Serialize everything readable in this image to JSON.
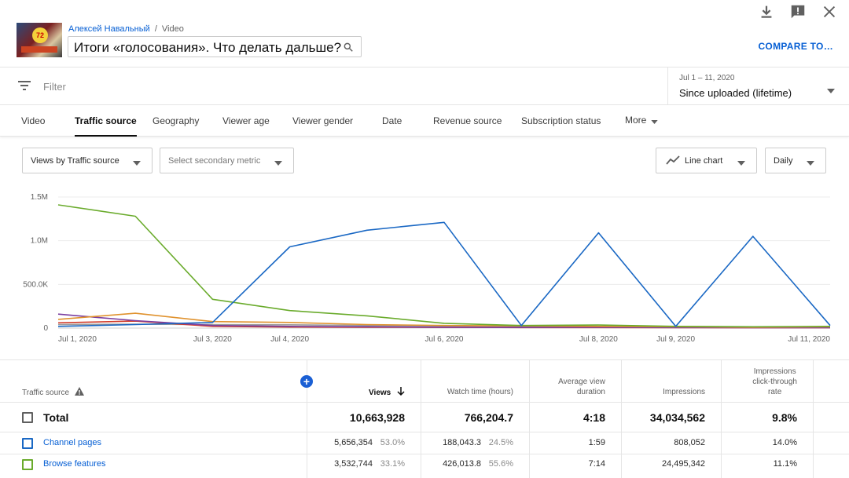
{
  "header": {
    "channel": "Алексей Навальный",
    "separator": "/",
    "section": "Video",
    "video_title": "Итоги «голосования». Что делать дальше?",
    "thumbnail_badge": "72",
    "compare_label": "COMPARE TO…"
  },
  "filter": {
    "placeholder": "Filter",
    "date_sub": "Jul 1 – 11, 2020",
    "date_main": "Since uploaded (lifetime)"
  },
  "tabs": [
    {
      "label": "Video"
    },
    {
      "label": "Traffic source"
    },
    {
      "label": "Geography"
    },
    {
      "label": "Viewer age"
    },
    {
      "label": "Viewer gender"
    },
    {
      "label": "Date"
    },
    {
      "label": "Revenue source"
    },
    {
      "label": "Subscription status"
    },
    {
      "label": "More"
    }
  ],
  "controls": {
    "primary_metric": "Views by Traffic source",
    "secondary_metric": "Select secondary metric",
    "chart_type": "Line chart",
    "granularity": "Daily"
  },
  "chart_data": {
    "type": "line",
    "x": [
      "Jul 1, 2020",
      "Jul 2, 2020",
      "Jul 3, 2020",
      "Jul 4, 2020",
      "Jul 5, 2020",
      "Jul 6, 2020",
      "Jul 7, 2020",
      "Jul 8, 2020",
      "Jul 9, 2020",
      "Jul 10, 2020",
      "Jul 11, 2020"
    ],
    "x_tick_labels": [
      "Jul 1, 2020",
      "Jul 3, 2020",
      "Jul 4, 2020",
      "Jul 6, 2020",
      "Jul 8, 2020",
      "Jul 9, 2020",
      "Jul 11, 2020"
    ],
    "y_ticks": [
      {
        "value": 0,
        "label": "0"
      },
      {
        "value": 500000,
        "label": "500.0K"
      },
      {
        "value": 1000000,
        "label": "1.0M"
      },
      {
        "value": 1500000,
        "label": "1.5M"
      }
    ],
    "ylim": [
      0,
      1500000
    ],
    "grid": true,
    "series": [
      {
        "color": "#1a68c4",
        "values": [
          20000,
          40000,
          65000,
          930000,
          1120000,
          1210000,
          30000,
          1090000,
          20000,
          1050000,
          30000
        ]
      },
      {
        "color": "#6aab2c",
        "values": [
          1410000,
          1280000,
          330000,
          200000,
          140000,
          55000,
          30000,
          35000,
          20000,
          15000,
          20000
        ]
      },
      {
        "color": "#e0922e",
        "values": [
          100000,
          170000,
          75000,
          65000,
          40000,
          30000,
          25000,
          20000,
          15000,
          10000,
          15000
        ]
      },
      {
        "color": "#7b3fa0",
        "values": [
          160000,
          85000,
          30000,
          20000,
          15000,
          10000,
          8000,
          8000,
          6000,
          5000,
          5000
        ]
      },
      {
        "color": "#d23c2a",
        "values": [
          60000,
          80000,
          20000,
          12000,
          10000,
          8000,
          6000,
          6000,
          5000,
          4000,
          4000
        ]
      },
      {
        "color": "#9a9a9a",
        "values": [
          40000,
          45000,
          40000,
          38000,
          30000,
          25000,
          20000,
          18000,
          15000,
          12000,
          12000
        ]
      }
    ]
  },
  "table": {
    "headers": {
      "source": "Traffic source",
      "views": "Views",
      "watch_time": "Watch time (hours)",
      "avg_duration_l1": "Average view",
      "avg_duration_l2": "duration",
      "impressions": "Impressions",
      "ctr_l1": "Impressions",
      "ctr_l2": "click-through",
      "ctr_l3": "rate"
    },
    "total": {
      "label": "Total",
      "views": "10,663,928",
      "watch_time": "766,204.7",
      "avg_duration": "4:18",
      "impressions": "34,034,562",
      "ctr": "9.8%"
    },
    "rows": [
      {
        "source": "Channel pages",
        "color": "#1a68c4",
        "views": "5,656,354",
        "views_pct": "53.0%",
        "watch_time": "188,043.3",
        "watch_pct": "24.5%",
        "avg_duration": "1:59",
        "impressions": "808,052",
        "ctr": "14.0%"
      },
      {
        "source": "Browse features",
        "color": "#6aab2c",
        "views": "3,532,744",
        "views_pct": "33.1%",
        "watch_time": "426,013.8",
        "watch_pct": "55.6%",
        "avg_duration": "7:14",
        "impressions": "24,495,342",
        "ctr": "11.1%"
      }
    ]
  }
}
